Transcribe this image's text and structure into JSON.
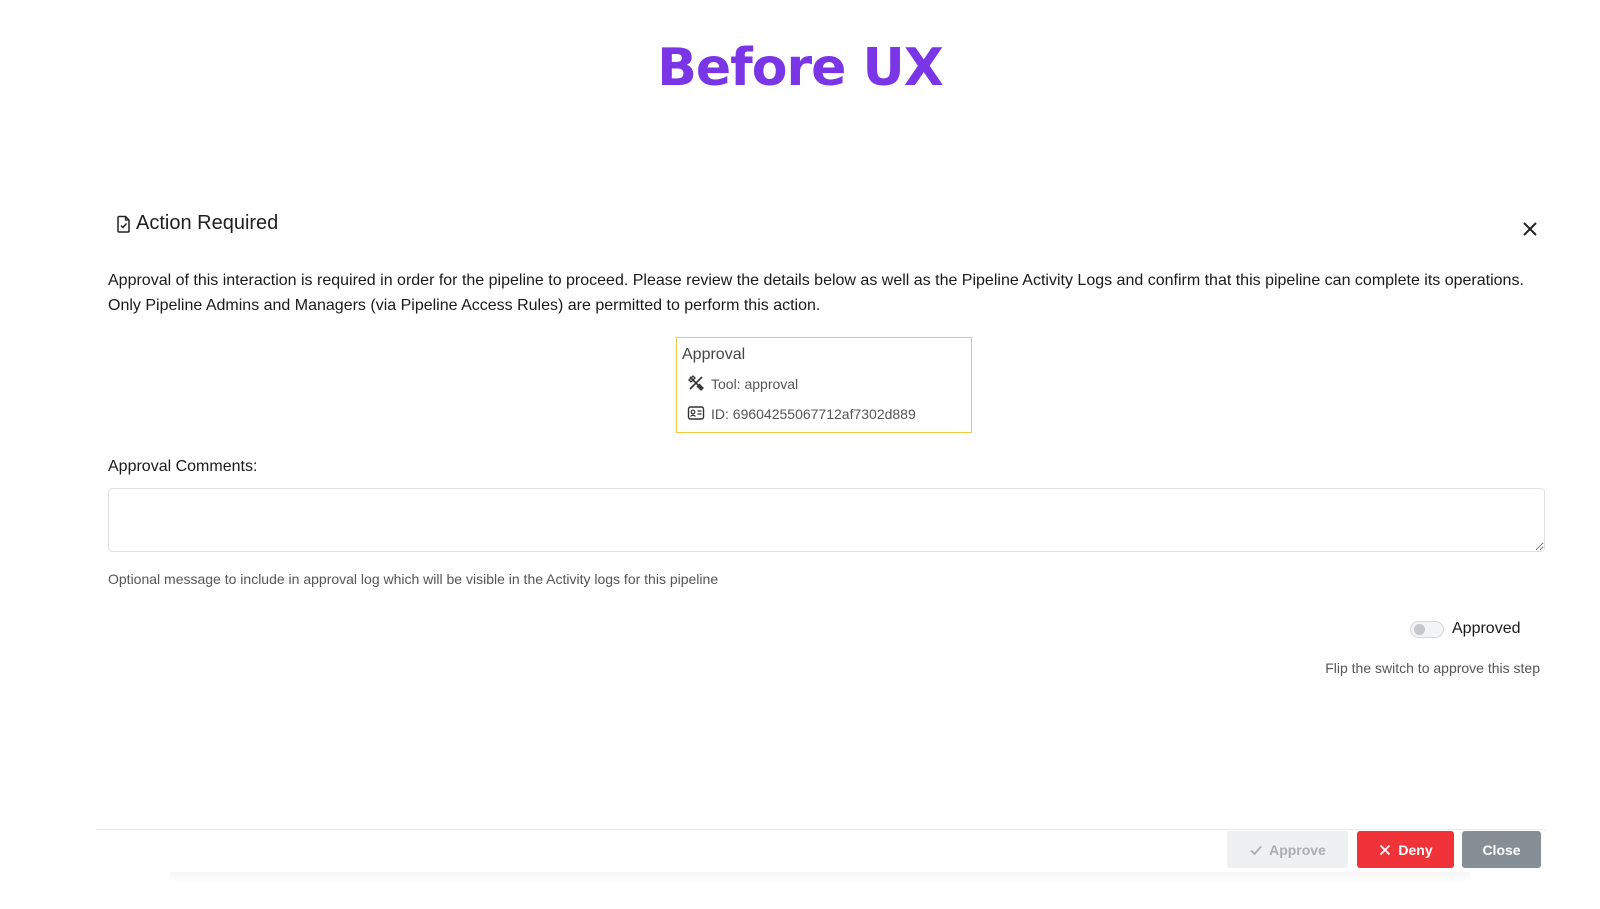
{
  "page": {
    "title": "Before UX"
  },
  "modal": {
    "title": "Action Required",
    "intro": "Approval of this interaction is required in order for the pipeline to proceed. Please review the details below as well as the Pipeline Activity Logs and confirm that this pipeline can complete its operations. Only Pipeline Admins and Managers (via Pipeline Access Rules) are permitted to perform this action."
  },
  "card": {
    "title": "Approval",
    "tool": "Tool: approval",
    "id": "ID: 69604255067712af7302d889",
    "border_color": "#f2c94c"
  },
  "comments": {
    "label": "Approval Comments:",
    "value": "",
    "placeholder": "",
    "helper": "Optional message to include in approval log which will be visible in the Activity logs for this pipeline"
  },
  "toggle": {
    "label": "Approved",
    "checked": false,
    "hint": "Flip the switch to approve this step"
  },
  "footer": {
    "approve_label": "Approve",
    "deny_label": "Deny",
    "close_label": "Close"
  },
  "colors": {
    "title": "#7a35e6",
    "deny": "#ef3338",
    "close": "#868e96",
    "approve_disabled": "#eef0f2"
  }
}
